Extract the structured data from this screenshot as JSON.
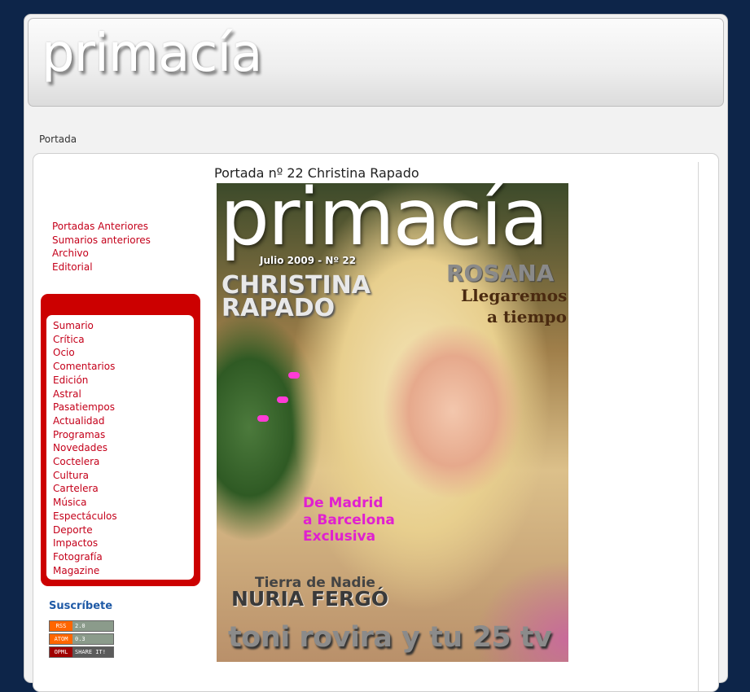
{
  "site": {
    "title": "primacía"
  },
  "breadcrumb": "Portada",
  "top_links": [
    "Portadas Anteriores",
    "Sumarios anteriores",
    "Archivo",
    "Editorial"
  ],
  "categories": [
    "Sumario",
    "Crítica",
    "Ocio",
    "Comentarios",
    "Edición",
    "Astral",
    "Pasatiempos",
    "Actualidad",
    "Programas",
    "Novedades",
    "Coctelera",
    "Cultura",
    "Cartelera",
    "Música",
    "Espectáculos",
    "Deporte",
    "Impactos",
    "Fotografía",
    "Magazine"
  ],
  "subscribe": {
    "heading": "Suscríbete",
    "feeds": [
      {
        "key": "RSS",
        "val": "2.0"
      },
      {
        "key": "ATOM",
        "val": "0.3"
      },
      {
        "key": "OPML",
        "val": "SHARE IT!"
      }
    ]
  },
  "cover": {
    "heading": "Portada nº 22 Christina Rapado",
    "logo": "primacía",
    "issue": "Julio 2009 - Nº 22",
    "name_line1": "CHRISTINA",
    "name_line2": "RAPADO",
    "rosana": "ROSANA",
    "llegaremos": "Llegaremos",
    "a_tiempo": "a tiempo",
    "pink_1": "De Madrid",
    "pink_2": "a Barcelona",
    "pink_3": "Exclusiva",
    "tierra": "Tierra de Nadie",
    "nuria": "NURIA FERGÓ",
    "toni": "toni rovira y tu 25 tv"
  },
  "colors": {
    "background": "#0d2549",
    "accent": "#cc0000",
    "link": "#c4001a",
    "subscribe": "#1f5aa6"
  }
}
